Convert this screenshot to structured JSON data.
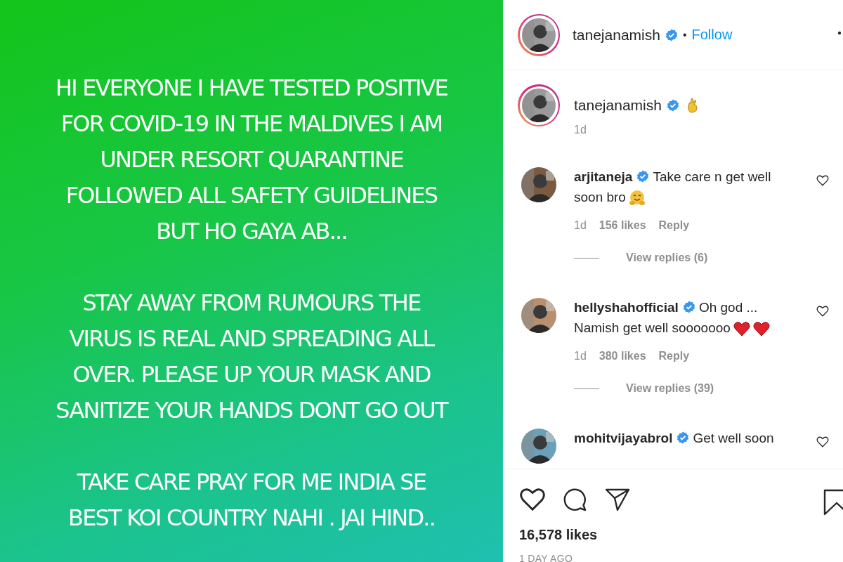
{
  "post_image": {
    "paragraphs": [
      [
        "HI EVERYONE I HAVE TESTED POSITIVE",
        "FOR COVID-19 IN THE MALDIVES I AM",
        "UNDER RESORT QUARANTINE",
        "FOLLOWED ALL SAFETY GUIDELINES",
        "BUT HO GAYA AB..."
      ],
      [
        "STAY AWAY FROM RUMOURS THE",
        "VIRUS IS REAL AND SPREADING ALL",
        "OVER. PLEASE UP YOUR MASK AND",
        "SANITIZE YOUR HANDS DONT GO OUT"
      ],
      [
        "TAKE CARE PRAY FOR ME INDIA SE",
        "BEST KOI COUNTRY NAHI . JAI HIND.."
      ]
    ]
  },
  "header": {
    "username": "tanejanamish",
    "verified": true,
    "separator": "•",
    "follow": "Follow"
  },
  "caption": {
    "username": "tanejanamish",
    "verified": true,
    "time": "1d"
  },
  "comments": [
    {
      "username": "arjitaneja",
      "verified": true,
      "text": "Take care n get well soon bro",
      "time": "1d",
      "likes": "156 likes",
      "reply": "Reply",
      "view_replies": "View replies (6)"
    },
    {
      "username": "hellyshahofficial",
      "verified": true,
      "text": "Oh god ... Namish get well sooooooo",
      "time": "1d",
      "likes": "380 likes",
      "reply": "Reply",
      "view_replies": "View replies (39)"
    },
    {
      "username": "mohitvijayabrol",
      "verified": true,
      "text": "Get well soon"
    }
  ],
  "likes": "16,578 likes",
  "posted": "1 DAY AGO"
}
